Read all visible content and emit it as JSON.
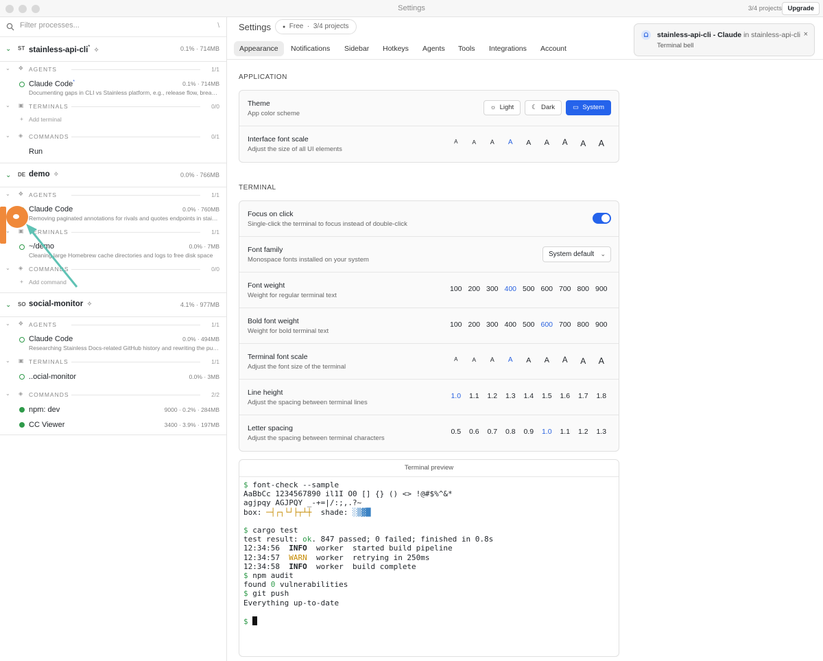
{
  "window": {
    "title": "Settings",
    "project_count": "3/4 projects",
    "upgrade_label": "Upgrade"
  },
  "sidebar": {
    "filter_placeholder": "Filter processes...",
    "filter_shortcut": "\\",
    "projects": [
      {
        "badge": "ST",
        "name": "stainless-api-cli",
        "name_mark": "*",
        "stat": "0.1% · 714MB",
        "agents": {
          "label": "AGENTS",
          "count": "1/1",
          "items": [
            {
              "title": "Claude Code",
              "mark": "*",
              "sub": "Documenting gaps in CLI vs Stainless platform, e.g., release flow, breakin...",
              "stat": "0.1% · 714MB"
            }
          ]
        },
        "terminals": {
          "label": "TERMINALS",
          "count": "0/0",
          "add": "Add terminal"
        },
        "commands": {
          "label": "COMMANDS",
          "count": "0/1",
          "items": [
            "Run"
          ]
        }
      },
      {
        "badge": "DE",
        "name": "demo",
        "stat": "0.0% · 766MB",
        "agents": {
          "label": "AGENTS",
          "count": "1/1",
          "items": [
            {
              "title": "Claude Code",
              "sub": "Removing paginated annotations for rivals and quotes endpoints in stainle...",
              "stat": "0.0% · 760MB"
            }
          ]
        },
        "terminals": {
          "label": "TERMINALS",
          "count": "1/1",
          "items": [
            {
              "title": "~/demo",
              "sub": "Cleaning large Homebrew cache directories and logs to free disk space",
              "stat": "0.0% · 7MB"
            }
          ]
        },
        "commands": {
          "label": "COMMANDS",
          "count": "0/0",
          "add": "Add command"
        }
      },
      {
        "badge": "SO",
        "name": "social-monitor",
        "stat": "4.1% · 977MB",
        "agents": {
          "label": "AGENTS",
          "count": "1/1",
          "items": [
            {
              "title": "Claude Code",
              "sub": "Researching Stainless Docs-related GitHub history and rewriting the publi...",
              "stat": "0.0% · 494MB"
            }
          ]
        },
        "terminals": {
          "label": "TERMINALS",
          "count": "1/1",
          "items": [
            {
              "title": "..ocial-monitor",
              "stat": "0.0% · 3MB"
            }
          ]
        },
        "commands": {
          "label": "COMMANDS",
          "count": "2/2",
          "items": [
            {
              "title": "npm: dev",
              "stat": "9000 · 0.2% · 284MB"
            },
            {
              "title": "CC Viewer",
              "stat": "3400 · 3.9% · 197MB"
            }
          ]
        }
      }
    ]
  },
  "main": {
    "title": "Settings",
    "plan": {
      "dot": "●",
      "name": "Free",
      "sep": "·",
      "usage": "3/4 projects"
    },
    "tabs": [
      "Appearance",
      "Notifications",
      "Sidebar",
      "Hotkeys",
      "Agents",
      "Tools",
      "Integrations",
      "Account"
    ],
    "active_tab": "Appearance",
    "application": {
      "title": "APPLICATION",
      "theme": {
        "title": "Theme",
        "desc": "App color scheme",
        "options": [
          "Light",
          "Dark",
          "System"
        ],
        "selected": "System"
      },
      "font_scale": {
        "title": "Interface font scale",
        "desc": "Adjust the size of all UI elements",
        "options": [
          "A",
          "A",
          "A",
          "A",
          "A",
          "A",
          "A",
          "A",
          "A"
        ],
        "selected_index": 3
      }
    },
    "terminal": {
      "title": "TERMINAL",
      "focus": {
        "title": "Focus on click",
        "desc": "Single-click the terminal to focus instead of double-click",
        "enabled": true
      },
      "font_family": {
        "title": "Font family",
        "desc": "Monospace fonts installed on your system",
        "value": "System default"
      },
      "font_weight": {
        "title": "Font weight",
        "desc": "Weight for regular terminal text",
        "options": [
          "100",
          "200",
          "300",
          "400",
          "500",
          "600",
          "700",
          "800",
          "900"
        ],
        "selected": "400"
      },
      "bold_weight": {
        "title": "Bold font weight",
        "desc": "Weight for bold terminal text",
        "options": [
          "100",
          "200",
          "300",
          "400",
          "500",
          "600",
          "700",
          "800",
          "900"
        ],
        "selected": "600"
      },
      "font_scale": {
        "title": "Terminal font scale",
        "desc": "Adjust the font size of the terminal",
        "options": [
          "A",
          "A",
          "A",
          "A",
          "A",
          "A",
          "A",
          "A",
          "A"
        ],
        "selected_index": 3
      },
      "line_height": {
        "title": "Line height",
        "desc": "Adjust the spacing between terminal lines",
        "options": [
          "1.0",
          "1.1",
          "1.2",
          "1.3",
          "1.4",
          "1.5",
          "1.6",
          "1.7",
          "1.8"
        ],
        "selected": "1.0"
      },
      "letter_spacing": {
        "title": "Letter spacing",
        "desc": "Adjust the spacing between terminal characters",
        "options": [
          "0.5",
          "0.6",
          "0.7",
          "0.8",
          "0.9",
          "1.0",
          "1.1",
          "1.2",
          "1.3"
        ],
        "selected": "1.0"
      }
    },
    "preview": {
      "title": "Terminal preview",
      "prompt": "$",
      "cmd1": "font-check --sample",
      "line_chars": "AaBbCc 1234567890 il1I O0 [] {} () <> !@#$%^&*",
      "line_glyphs": "agjpqy AGJPQY _-+=|/:;,.?~",
      "box_label": "box:",
      "box_chars": "─┤┌┐└┘├┬┴┼",
      "shade_label": "shade:",
      "shade_chars": "░▒▓█",
      "cmd2": "cargo test",
      "test_prefix": "test result:",
      "test_ok": "ok",
      "test_rest": ". 847 passed; 0 failed; finished in 0.8s",
      "logs": [
        {
          "time": "12:34:56",
          "level": "INFO",
          "msg": "worker  started build pipeline"
        },
        {
          "time": "12:34:57",
          "level": "WARN",
          "msg": "worker  retrying in 250ms"
        },
        {
          "time": "12:34:58",
          "level": "INFO",
          "msg": "worker  build complete"
        }
      ],
      "cmd3": "npm audit",
      "audit_pre": "found",
      "audit_num": "0",
      "audit_post": "vulnerabilities",
      "cmd4": "git push",
      "push_result": "Everything up-to-date"
    }
  },
  "notification": {
    "project": "stainless-api-cli",
    "sep": "-",
    "agent": "Claude",
    "location": "in stainless-api-cli",
    "body": "Terminal bell",
    "close": "×"
  },
  "colors": {
    "accent": "#2563eb",
    "status_green": "#2f9a4a",
    "annotation": "#f0893a",
    "annotation_arrow": "#5fc2b4"
  }
}
